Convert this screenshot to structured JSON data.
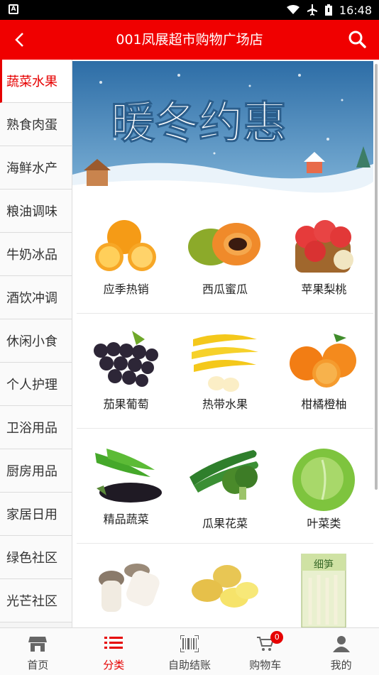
{
  "status": {
    "time": "16:48",
    "app_badge": "A"
  },
  "header": {
    "title": "001凤展超市购物广场店"
  },
  "sidebar": {
    "items": [
      {
        "label": "蔬菜水果"
      },
      {
        "label": "熟食肉蛋"
      },
      {
        "label": "海鲜水产"
      },
      {
        "label": "粮油调味"
      },
      {
        "label": "牛奶冰品"
      },
      {
        "label": "酒饮冲调"
      },
      {
        "label": "休闲小食"
      },
      {
        "label": "个人护理"
      },
      {
        "label": "卫浴用品"
      },
      {
        "label": "厨房用品"
      },
      {
        "label": "家居日用"
      },
      {
        "label": "绿色社区"
      },
      {
        "label": "光芒社区"
      }
    ]
  },
  "banner": {
    "text": "暖冬约惠"
  },
  "categories": [
    {
      "label": "应季热销",
      "icon": "orange-icon"
    },
    {
      "label": "西瓜蜜瓜",
      "icon": "papaya-icon"
    },
    {
      "label": "苹果梨桃",
      "icon": "apple-icon"
    },
    {
      "label": "茄果葡萄",
      "icon": "grape-icon"
    },
    {
      "label": "热带水果",
      "icon": "banana-icon"
    },
    {
      "label": "柑橘橙柚",
      "icon": "tangerine-icon"
    },
    {
      "label": "精品蔬菜",
      "icon": "pepper-eggplant-icon"
    },
    {
      "label": "瓜果花菜",
      "icon": "cucumber-broccoli-icon"
    },
    {
      "label": "叶菜类",
      "icon": "lettuce-icon"
    },
    {
      "label": "",
      "icon": "mushroom-icon"
    },
    {
      "label": "",
      "icon": "potato-icon"
    },
    {
      "label": "",
      "icon": "bamboo-shoot-pack-icon",
      "pack_text": "细笋"
    }
  ],
  "tabs": [
    {
      "label": "首页",
      "icon": "store-icon"
    },
    {
      "label": "分类",
      "icon": "list-icon"
    },
    {
      "label": "自助结账",
      "icon": "barcode-icon"
    },
    {
      "label": "购物车",
      "icon": "cart-icon",
      "badge": "0"
    },
    {
      "label": "我的",
      "icon": "user-icon"
    }
  ],
  "colors": {
    "brand": "#f00000",
    "active": "#e60000"
  }
}
